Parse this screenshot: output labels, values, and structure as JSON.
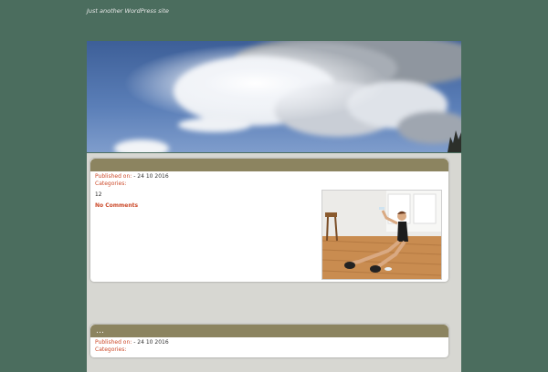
{
  "site": {
    "title_first": "",
    "title_rest": "",
    "tagline": "Just another WordPress site"
  },
  "posts": [
    {
      "title": "",
      "published_label": "Published on:",
      "author": "",
      "date": "- 24 10 2016",
      "categories_label": "Categories:",
      "category": "",
      "paragraphs": [
        "",
        "",
        "12",
        "",
        "",
        "",
        ""
      ],
      "link_text": "",
      "after_link": "",
      "comments": "No Comments"
    },
    {
      "title": "…",
      "published_label": "Published on:",
      "author": "",
      "date": "- 24 10 2016",
      "categories_label": "Categories:",
      "category": "",
      "paragraphs": [
        ""
      ]
    }
  ],
  "colors": {
    "page_bg": "#4b6d5e",
    "title_bar": "#8c8460",
    "accent": "#cc4a2a"
  },
  "icons": {
    "banner": "sky-clouds-image",
    "featured": "woman-drinking-water-image"
  }
}
